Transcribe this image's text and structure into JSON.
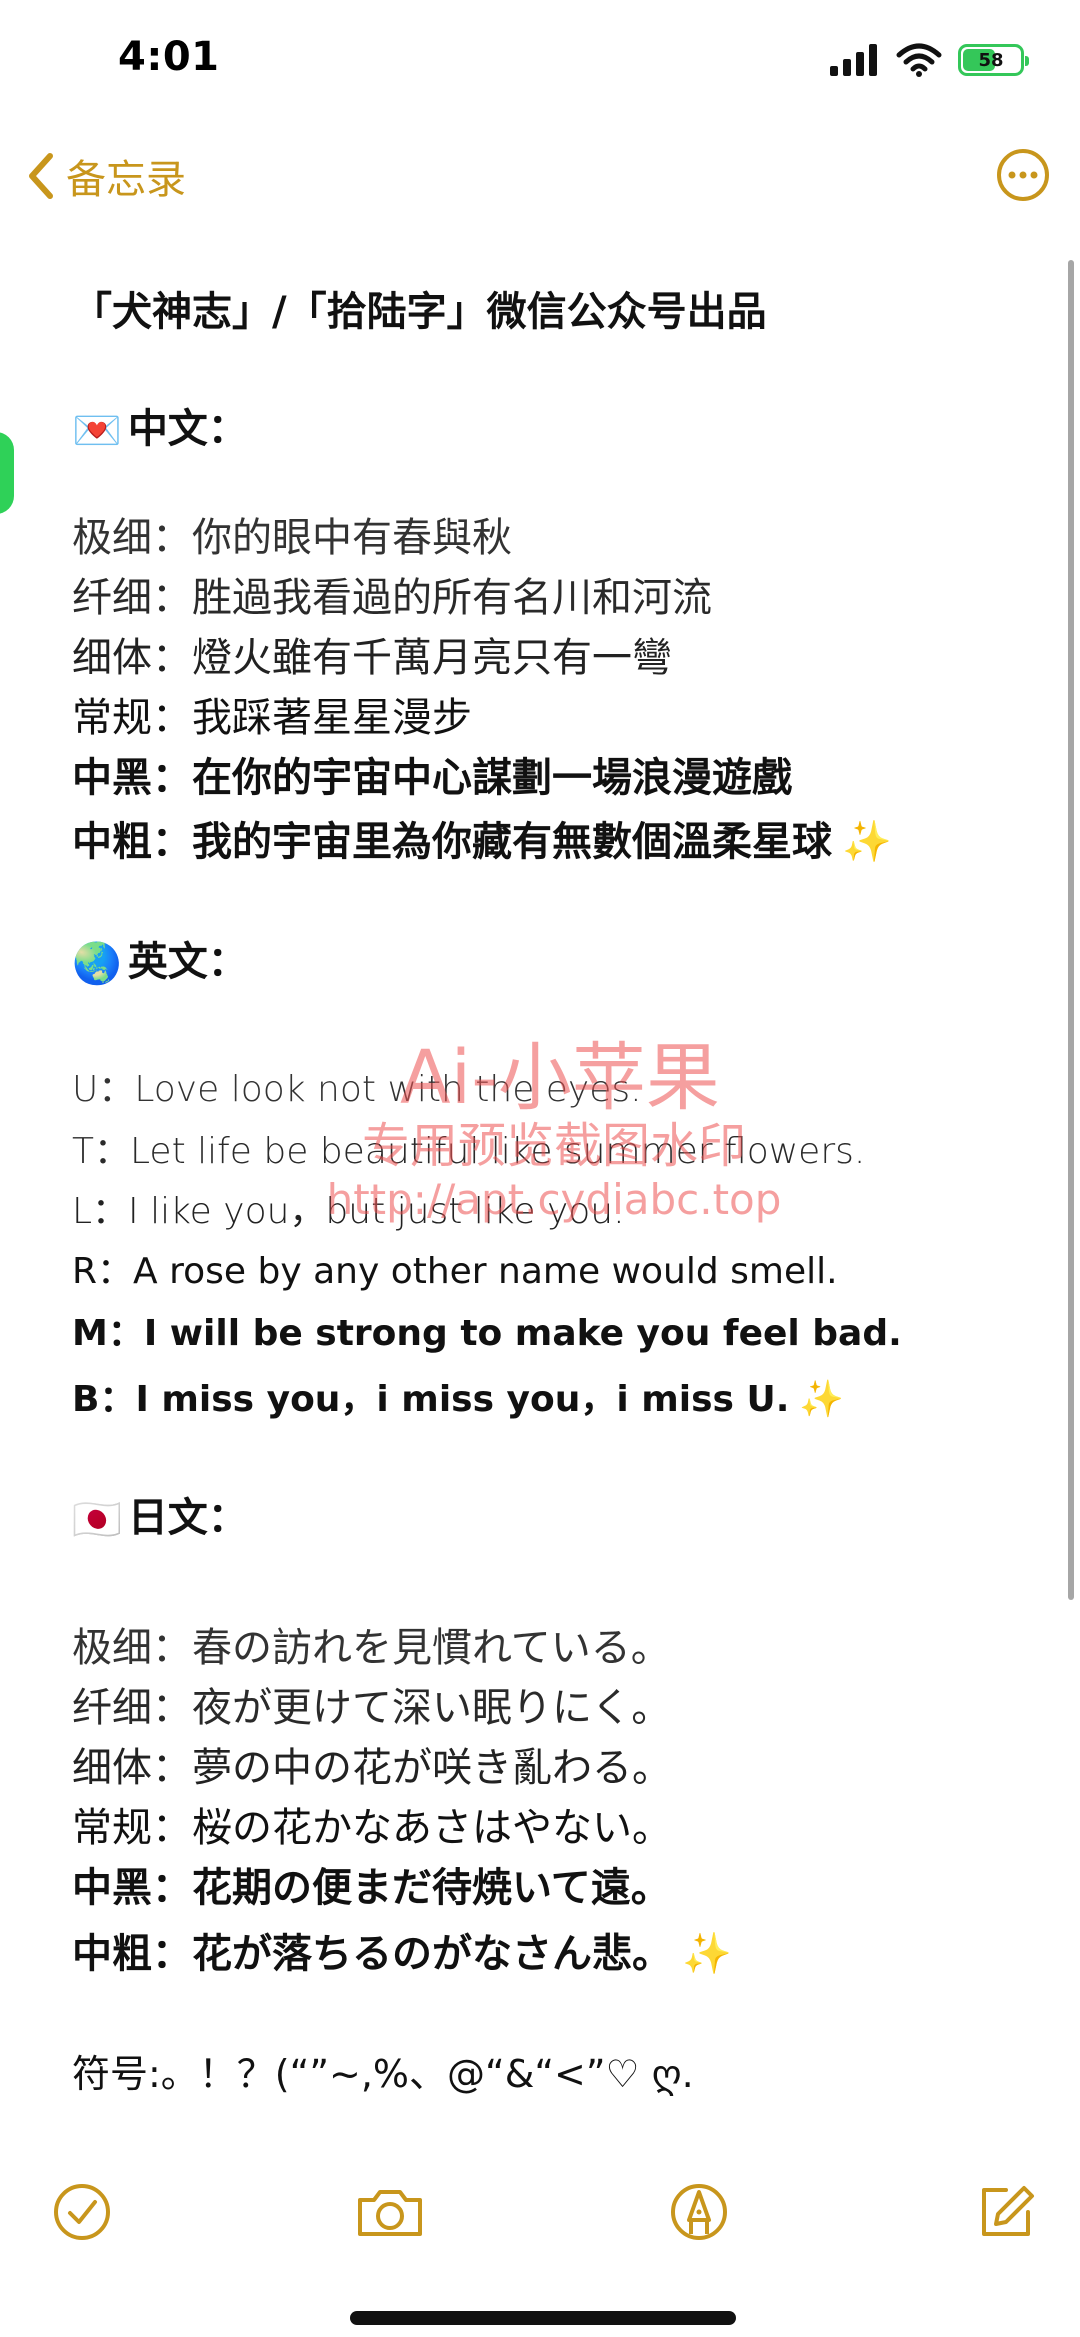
{
  "status": {
    "time": "4:01",
    "battery_level": "58",
    "battery_fraction": 0.58
  },
  "nav": {
    "back_label": "备忘录",
    "accent_color": "#c8961c"
  },
  "note": {
    "header": "「犬神志」/「拾陆字」微信公众号出品",
    "chinese": {
      "heading": "中文：",
      "emoji": "💌",
      "lines": [
        "极细：你的眼中有春與秋",
        "纤细：胜過我看過的所有名川和河流",
        "细体：燈火雖有千萬月亮只有一彎",
        "常规：我踩著星星漫步",
        "中黑：在你的宇宙中心謀劃一場浪漫遊戲",
        "中粗：我的宇宙里為你藏有無數個溫柔星球"
      ],
      "sparkle": "✨"
    },
    "english": {
      "heading": "英文：",
      "emoji": "🌏",
      "lines": [
        "U：Love look not with the eyes.",
        "T：Let life be beautiful like summer flowers.",
        "L：I like you，but just like you.",
        "R：A rose by any other name would smell.",
        "M：I will be strong to make you feel bad.",
        "B：I miss you，i miss you，i miss U."
      ],
      "sparkle": "✨"
    },
    "japanese": {
      "heading": "日文：",
      "emoji": "🇯🇵",
      "lines": [
        "极细：春の訪れを見慣れている。",
        "纤细：夜が更けて深い眠りにく。",
        "细体：夢の中の花が咲き亂わる。",
        "常规：桜の花かなあさはやない。",
        "中黑：花期の便まだ待焼いて遠。",
        "中粗：花が落ちるのがなさん悲。"
      ],
      "sparkle": "✨"
    },
    "symbols": "符号:。！？(“”~,%、@“&“<”♡ ღ."
  },
  "watermark": {
    "line1": "Ai-小苹果",
    "line2": "专用预览截图水印",
    "line3": "http://apt.cydiabc.top"
  },
  "icons": {
    "back": "chevron-left-icon",
    "more": "ellipsis-circle-icon",
    "checklist": "checkmark-circle-icon",
    "camera": "camera-icon",
    "markup": "pen-tip-circle-icon",
    "compose": "compose-icon"
  }
}
